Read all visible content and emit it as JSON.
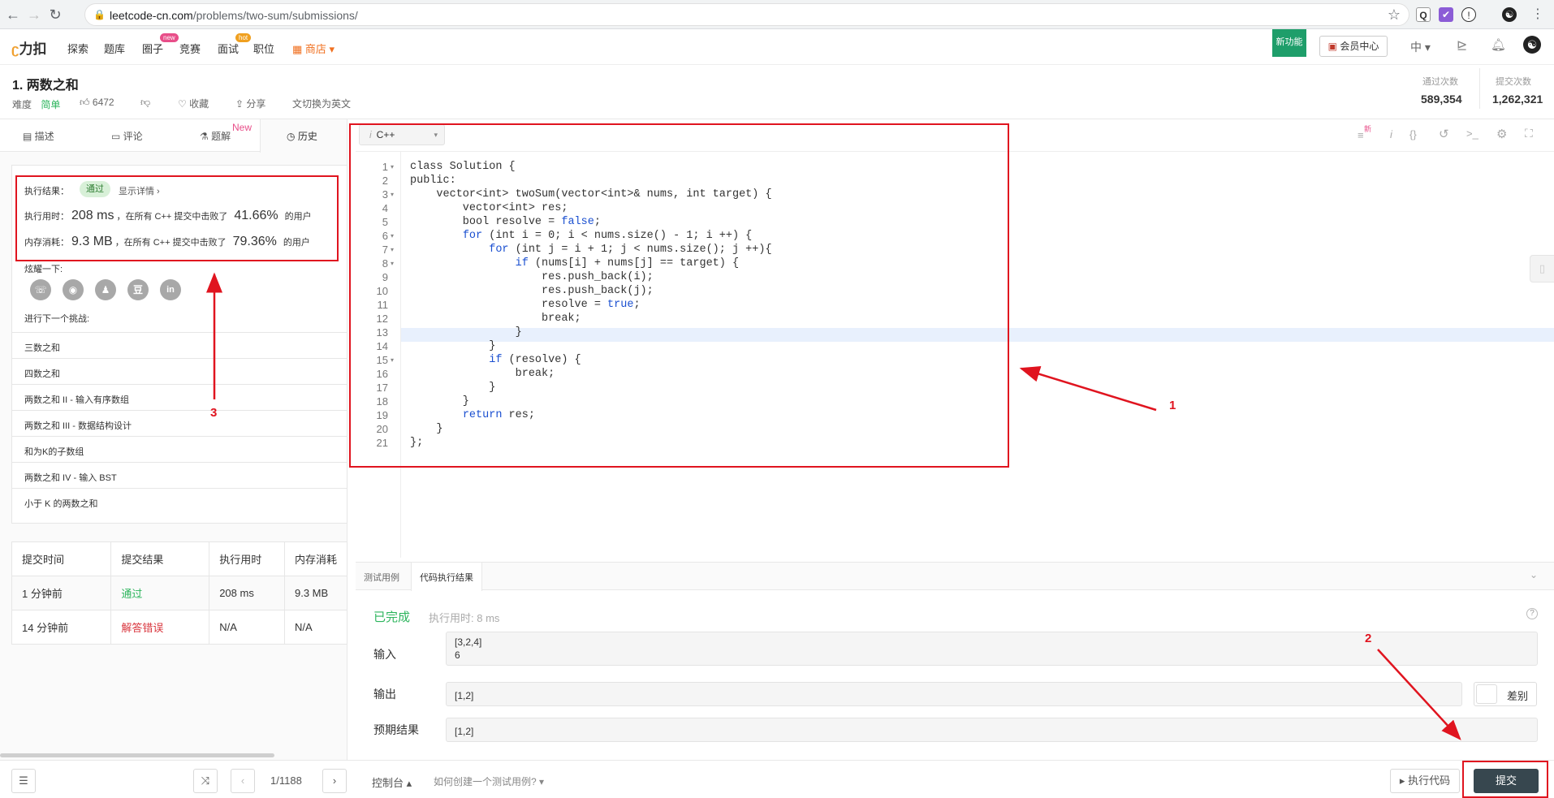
{
  "browser": {
    "url_host": "leetcode-cn.com",
    "url_path": "/problems/two-sum/submissions/"
  },
  "site": {
    "logo": "力扣",
    "nav": [
      "探索",
      "题库",
      "圈子",
      "竞赛",
      "面试",
      "职位"
    ],
    "badge_new": "new",
    "badge_hot": "hot",
    "store": "商店",
    "new_feature": "新功能",
    "member": "会员中心",
    "lang": "中"
  },
  "problem": {
    "title": "1. 两数之和",
    "difficulty_label": "难度",
    "difficulty": "简单",
    "likes": "6472",
    "favorite": "收藏",
    "share": "分享",
    "switch_lang": "切换为英文",
    "pass_label": "通过次数",
    "pass_count": "589,354",
    "submit_label": "提交次数",
    "submit_count": "1,262,321"
  },
  "left_tabs": {
    "desc": "描述",
    "comments": "评论",
    "solutions": "题解",
    "solutions_badge": "New",
    "history": "历史"
  },
  "result": {
    "exec_label": "执行结果：",
    "status": "通过",
    "detail": "显示详情 ›",
    "time_label": "执行用时：",
    "time_value": "208 ms",
    "time_mid": "，在所有 C++ 提交中击败了",
    "time_pct": "41.66%",
    "time_tail": "的用户",
    "mem_label": "内存消耗：",
    "mem_value": "9.3 MB",
    "mem_mid": "，在所有 C++ 提交中击败了",
    "mem_pct": "79.36%",
    "mem_tail": "的用户",
    "share_label": "炫耀一下:",
    "next_label": "进行下一个挑战:"
  },
  "challenges": [
    "三数之和",
    "四数之和",
    "两数之和 II - 输入有序数组",
    "两数之和 III - 数据结构设计",
    "和为K的子数组",
    "两数之和 IV - 输入 BST",
    "小于 K 的两数之和"
  ],
  "submissions": {
    "headers": [
      "提交时间",
      "提交结果",
      "执行用时",
      "内存消耗"
    ],
    "rows": [
      [
        "1 分钟前",
        "通过",
        "208 ms",
        "9.3 MB"
      ],
      [
        "14 分钟前",
        "解答错误",
        "N/A",
        "N/A"
      ]
    ]
  },
  "editor": {
    "language": "C++",
    "new_badge": "新",
    "lines": [
      "class Solution {",
      "public:",
      "    vector<int> twoSum(vector<int>& nums, int target) {",
      "        vector<int> res;",
      "        bool resolve = false;",
      "        for (int i = 0; i < nums.size() - 1; i ++) {",
      "            for (int j = i + 1; j < nums.size(); j ++){",
      "                if (nums[i] + nums[j] == target) {",
      "                    res.push_back(i);",
      "                    res.push_back(j);",
      "                    resolve = true;",
      "                    break;",
      "                }",
      "            }",
      "            if (resolve) {",
      "                break;",
      "            }",
      "        }",
      "        return res;",
      "    }",
      "};"
    ]
  },
  "console": {
    "tab_test": "测试用例",
    "tab_result": "代码执行结果",
    "done": "已完成",
    "exec_time": "执行用时: 8 ms",
    "input_label": "输入",
    "input_line1": "[3,2,4]",
    "input_line2": "6",
    "output_label": "输出",
    "output_value": "[1,2]",
    "diff": "差别",
    "expected_label": "预期结果",
    "expected_value": "[1,2]"
  },
  "footer": {
    "page": "1/1188",
    "console": "控制台",
    "how_to": "如何创建一个测试用例?",
    "run": "执行代码",
    "submit": "提交"
  },
  "annotations": {
    "n1": "1",
    "n2": "2",
    "n3": "3"
  },
  "colors": {
    "accent_green": "#2db55d",
    "annotation_red": "#e0141f",
    "submit_bg": "#37474f"
  }
}
